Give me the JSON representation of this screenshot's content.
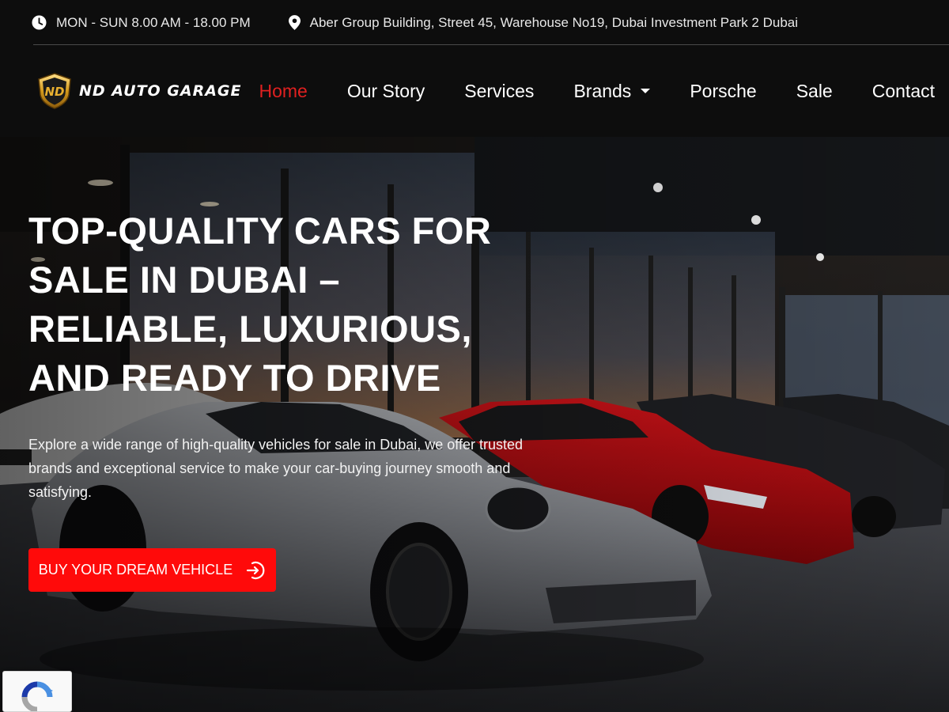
{
  "topbar": {
    "hours": "MON - SUN 8.00 AM - 18.00 PM",
    "address": "Aber Group Building, Street 45, Warehouse No19, Dubai Investment Park 2 Dubai",
    "icons": [
      "clock-icon",
      "map-pin-icon"
    ]
  },
  "brand": {
    "logo_text": "ND AUTO GARAGE",
    "badge_text": "ND"
  },
  "nav": {
    "items": [
      {
        "label": "Home",
        "active": true
      },
      {
        "label": "Our Story"
      },
      {
        "label": "Services"
      },
      {
        "label": "Brands",
        "has_dropdown": true
      },
      {
        "label": "Porsche"
      },
      {
        "label": "Sale"
      },
      {
        "label": "Contact"
      }
    ]
  },
  "hero": {
    "headline": "TOP-QUALITY CARS FOR SALE IN DUBAI – RELIABLE, LUXURIOUS, AND READY TO DRIVE",
    "lead": "Explore a wide range of high-quality vehicles for sale in Dubai, we offer trusted brands and exceptional service to make your car-buying journey smooth and satisfying.",
    "cta_label": "BUY YOUR DREAM VEHICLE",
    "cta_icon": "arrow-right-circle-icon"
  },
  "colors": {
    "accent": "#ff0a0a",
    "active_nav": "#e02020",
    "background": "#0d0d0d"
  }
}
